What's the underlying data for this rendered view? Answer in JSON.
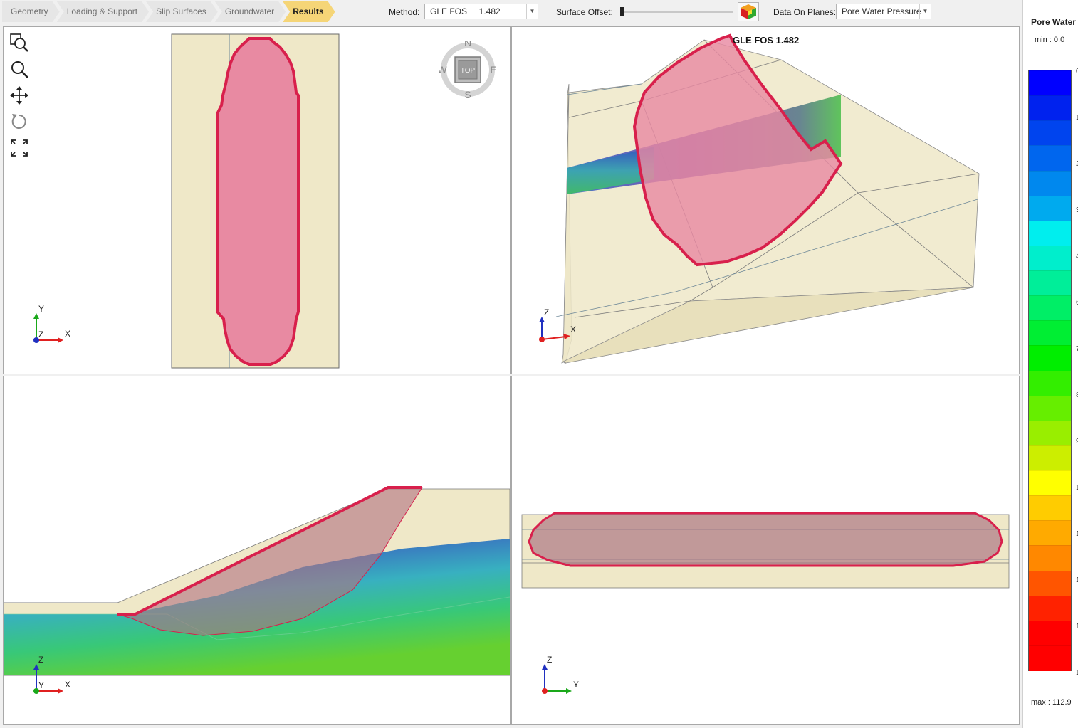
{
  "workflow_tabs": [
    {
      "label": "Geometry",
      "active": false
    },
    {
      "label": "Loading & Support",
      "active": false
    },
    {
      "label": "Slip Surfaces",
      "active": false
    },
    {
      "label": "Groundwater",
      "active": false
    },
    {
      "label": "Results",
      "active": true
    }
  ],
  "toolbar": {
    "method_label": "Method:",
    "method_value": "GLE FOS     1.482",
    "surface_offset_label": "Surface Offset:",
    "surface_offset_fraction": 0.0,
    "data_planes_label": "Data On Planes:",
    "data_planes_value": "Pore Water Pressure"
  },
  "view_tools": [
    "zoom-extents-icon",
    "zoom-icon",
    "pan-icon",
    "rotate-icon",
    "fullscreen-icon"
  ],
  "compass": {
    "n": "N",
    "s": "S",
    "e": "E",
    "w": "W",
    "center": "TOP"
  },
  "viewports": {
    "top": {
      "axis_h": "X",
      "axis_v": "Y",
      "axis_o": "Z"
    },
    "perspective": {
      "fos_label": "GLE FOS 1.482",
      "axis_h": "X",
      "axis_v": "Z"
    },
    "front": {
      "axis_h": "X",
      "axis_v": "Z",
      "axis_o": "Y"
    },
    "side": {
      "axis_h": "Y",
      "axis_v": "Z"
    }
  },
  "legend": {
    "title": "Pore Water",
    "min_text": "min :   0.0",
    "max_text": "max :  112.9",
    "colors": [
      "#0000ff",
      "#0022ee",
      "#0044ee",
      "#0066ee",
      "#0088ee",
      "#00aaee",
      "#00eeee",
      "#00eecc",
      "#00ee99",
      "#00ee66",
      "#00ee33",
      "#00ee00",
      "#33ee00",
      "#66ee00",
      "#99ee00",
      "#ccee00",
      "#ffff00",
      "#ffcc00",
      "#ffaa00",
      "#ff8800",
      "#ff5500",
      "#ff2200",
      "#ff0000",
      "#ff0000"
    ],
    "ticks": [
      "0",
      "1",
      "2",
      "3",
      "4",
      "6",
      "7",
      "8",
      "9",
      "1",
      "1",
      "1",
      "1",
      "1"
    ]
  },
  "colors": {
    "slope_fill": "#efe8c8",
    "slip_fill": "#e88aa2",
    "slip_stroke": "#d8204c",
    "active_tab": "#f5d577"
  }
}
